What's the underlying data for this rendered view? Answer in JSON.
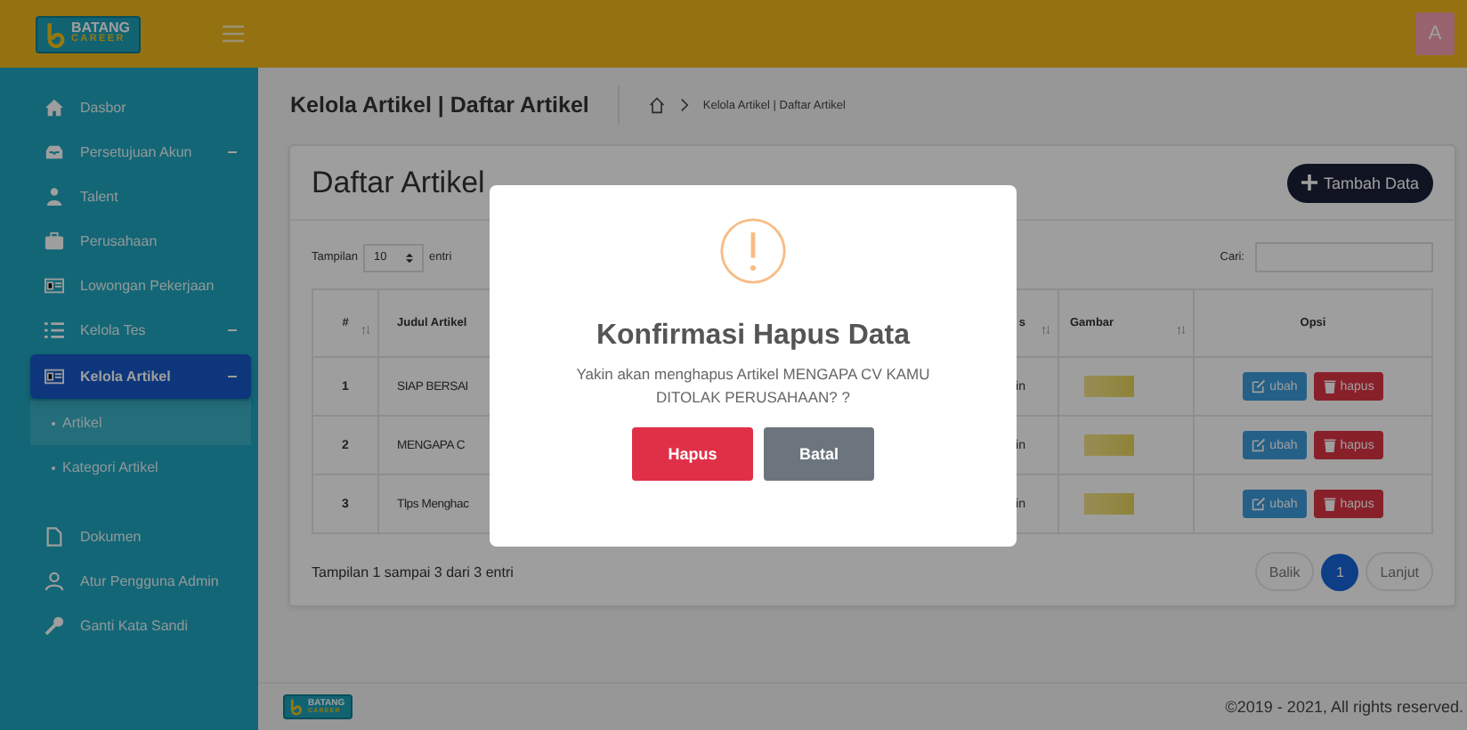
{
  "topbar": {
    "logo": {
      "line1": "BATANG",
      "line2": "CAREER"
    },
    "avatar": "A"
  },
  "sidebar": {
    "items": [
      {
        "label": "Dasbor",
        "kind": "link",
        "selected": false
      },
      {
        "label": "Persetujuan Akun",
        "kind": "menu",
        "selected": false
      },
      {
        "label": "Talent",
        "kind": "link",
        "selected": false
      },
      {
        "label": "Perusahaan",
        "kind": "link",
        "selected": false
      },
      {
        "label": "Lowongan Pekerjaan",
        "kind": "link",
        "selected": false
      },
      {
        "label": "Kelola Tes",
        "kind": "menu",
        "selected": false
      },
      {
        "label": "Kelola Artikel",
        "kind": "menu",
        "selected": true,
        "children": [
          {
            "label": "Artikel",
            "selected": true
          },
          {
            "label": "Kategori Artikel",
            "selected": false
          }
        ]
      },
      {
        "label": "Dokumen",
        "kind": "link",
        "selected": false
      },
      {
        "label": "Atur Pengguna Admin",
        "kind": "link",
        "selected": false
      },
      {
        "label": "Ganti Kata Sandi",
        "kind": "link",
        "selected": false
      }
    ]
  },
  "header": {
    "title": "Kelola Artikel | Daftar Artikel",
    "breadcrumb": "Kelola Artikel | Daftar Artikel"
  },
  "card": {
    "title": "Daftar Artikel",
    "add_button": "Tambah Data",
    "length_label": "Tampilan",
    "length_value": "10",
    "length_suffix": "entri",
    "search_label": "Cari:"
  },
  "table": {
    "columns": [
      {
        "label": "#",
        "sortable": true
      },
      {
        "label": "Judul Artikel"
      },
      {
        "label": "s",
        "sortable": true
      },
      {
        "label": "Gambar",
        "sortable": true
      },
      {
        "label": "Opsi",
        "sortable": false
      }
    ],
    "rows": [
      {
        "no": "1",
        "title": "SIAP BERSAI",
        "column_3": "in",
        "edit": "ubah",
        "delete": "hapus"
      },
      {
        "no": "2",
        "title": "MENGAPA C",
        "column_3": "in",
        "edit": "ubah",
        "delete": "hapus"
      },
      {
        "no": "3",
        "title": "Tlps Menghac",
        "column_3": "in",
        "edit": "ubah",
        "delete": "hapus"
      }
    ]
  },
  "info": "Tampilan 1 sampai 3 dari 3 entri",
  "pagination": {
    "prev": "Balik",
    "pages": [
      {
        "label": "1",
        "selected": true
      }
    ],
    "next": "Lanjut"
  },
  "footer": {
    "logo": {
      "line1": "BATANG",
      "line2": "CAREER"
    },
    "copyright": "©2019 - 2021, All rights reserved."
  },
  "modal": {
    "title": "Konfirmasi Hapus Data",
    "message": "Yakin akan menghapus Artikel MENGAPA CV KAMU DITOLAK PERUSAHAAN? ?",
    "confirm": "Hapus",
    "cancel": "Batal"
  }
}
